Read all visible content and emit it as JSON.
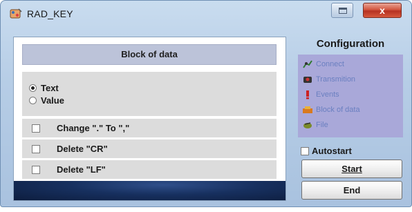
{
  "window": {
    "title": "RAD_KEY",
    "close_glyph": "x"
  },
  "left": {
    "header": "Block of data",
    "radio_options": [
      {
        "label": "Text",
        "selected": true
      },
      {
        "label": "Value",
        "selected": false
      }
    ],
    "checks": [
      {
        "label": "Change \".\" To \",\"",
        "checked": false
      },
      {
        "label": "Delete \"CR\"",
        "checked": false
      },
      {
        "label": "Delete \"LF\"",
        "checked": false
      }
    ]
  },
  "right": {
    "config_title": "Configuration",
    "menu": [
      {
        "label": "Connect",
        "icon": "connect-icon"
      },
      {
        "label": "Transmition",
        "icon": "transmission-icon"
      },
      {
        "label": "Events",
        "icon": "events-icon"
      },
      {
        "label": "Block of data",
        "icon": "block-of-data-icon"
      },
      {
        "label": "File",
        "icon": "file-icon"
      }
    ],
    "autostart_label": "Autostart",
    "start_label": "Start",
    "end_label": "End"
  },
  "colors": {
    "menu_text": "#6a7fc0",
    "menu_bg": "#a9a8d9",
    "header_bg": "#bcc3d9",
    "close_red": "#c8442d"
  }
}
